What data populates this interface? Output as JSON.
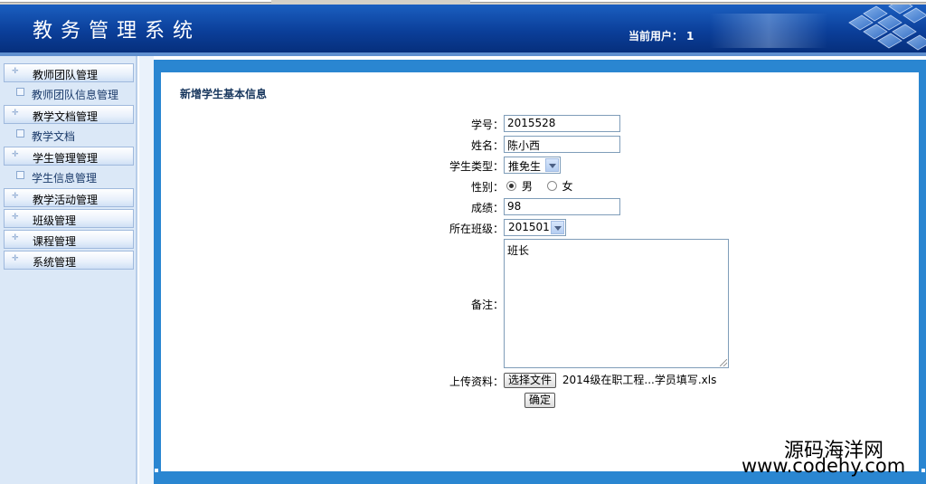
{
  "app": {
    "title": "教务管理系统",
    "current_user_label": "当前用户：",
    "current_user_value": "1"
  },
  "sidebar": {
    "items": [
      {
        "label": "教师团队管理",
        "type": "group"
      },
      {
        "label": "教师团队信息管理",
        "type": "sub"
      },
      {
        "label": "教学文档管理",
        "type": "group"
      },
      {
        "label": "教学文档",
        "type": "sub"
      },
      {
        "label": "学生管理管理",
        "type": "group"
      },
      {
        "label": "学生信息管理",
        "type": "sub"
      },
      {
        "label": "教学活动管理",
        "type": "group"
      },
      {
        "label": "班级管理",
        "type": "group"
      },
      {
        "label": "课程管理",
        "type": "group"
      },
      {
        "label": "系统管理",
        "type": "group"
      }
    ]
  },
  "form": {
    "title": "新增学生基本信息",
    "student_id": {
      "label": "学号：",
      "value": "2015528"
    },
    "name": {
      "label": "姓名：",
      "value": "陈小西"
    },
    "student_type": {
      "label": "学生类型：",
      "value": "推免生"
    },
    "gender": {
      "label": "性别：",
      "options": [
        "男",
        "女"
      ],
      "selected": "男"
    },
    "score": {
      "label": "成绩：",
      "value": "98"
    },
    "class": {
      "label": "所在班级：",
      "value": "201501"
    },
    "remark": {
      "label": "备注：",
      "value": "班长"
    },
    "upload": {
      "label": "上传资料：",
      "button": "选择文件",
      "filename": "2014级在职工程...学员填写.xls"
    },
    "submit": "确定"
  },
  "watermark": {
    "line1": "源码海洋网",
    "line2": "www.codehy.com"
  }
}
